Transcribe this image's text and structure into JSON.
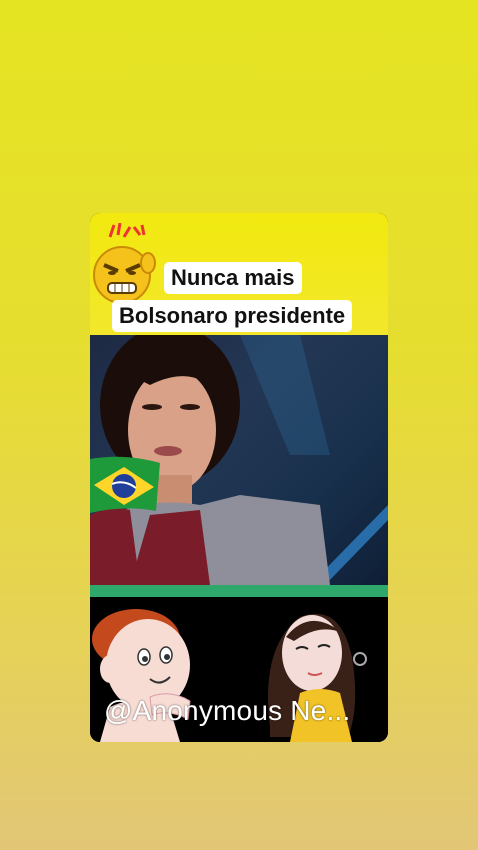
{
  "post": {
    "caption_line1": "Nunca mais",
    "caption_line2": "Bolsonaro presidente",
    "watermark": "@Anonymous Ne..."
  },
  "icons": {
    "angry_emoji": "angry-face-emoji",
    "flag": "brazil-flag",
    "boy_cartoon": "cartoon-boy-sticker",
    "girl_cartoon": "cartoon-girl-sticker"
  },
  "colors": {
    "background_top": "#e5e422",
    "background_bottom": "#e2c677",
    "caption_bg": "#ffffff",
    "video_strip": "#2fa86b"
  }
}
